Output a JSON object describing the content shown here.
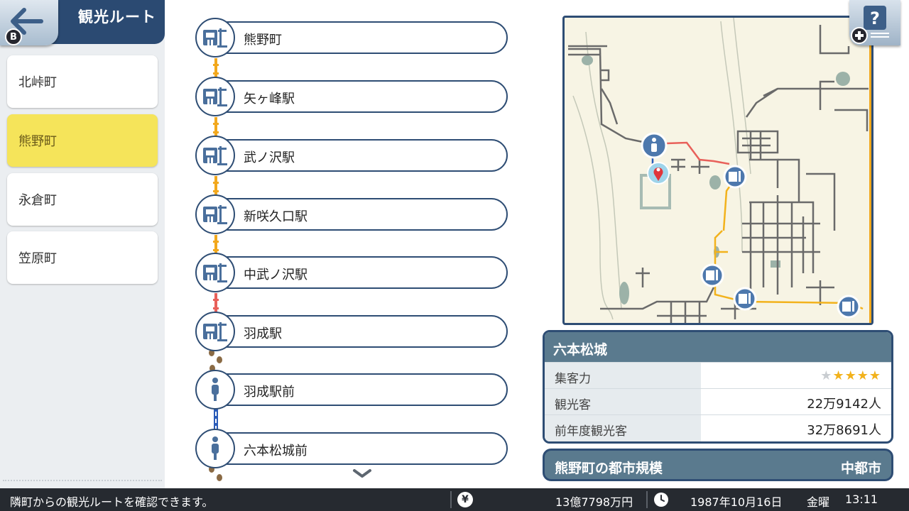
{
  "header": {
    "title": "観光ルート",
    "back_badge": "B"
  },
  "towns": [
    {
      "label": "北峠町",
      "selected": false
    },
    {
      "label": "熊野町",
      "selected": true
    },
    {
      "label": "永倉町",
      "selected": false
    },
    {
      "label": "笠原町",
      "selected": false
    }
  ],
  "route": [
    {
      "label": "熊野町",
      "icon": "station-icon"
    },
    {
      "label": "矢ヶ峰駅",
      "icon": "station-icon"
    },
    {
      "label": "武ノ沢駅",
      "icon": "station-icon"
    },
    {
      "label": "新咲久口駅",
      "icon": "station-icon"
    },
    {
      "label": "中武ノ沢駅",
      "icon": "station-icon"
    },
    {
      "label": "羽成駅",
      "icon": "station-icon"
    },
    {
      "label": "羽成駅前",
      "icon": "bus-stop-icon"
    },
    {
      "label": "六本松城前",
      "icon": "bus-stop-icon"
    }
  ],
  "connectors": [
    "rail-orange",
    "rail-orange",
    "rail-orange",
    "rail-orange",
    "rail-red",
    "walk",
    "bus-blue",
    "walk"
  ],
  "colors": {
    "rail_orange": "#f2a81d",
    "rail_red": "#e8605a",
    "bus_blue": "#2a5bb8",
    "walk": "#8a6a44",
    "navy": "#2e4d74",
    "selected_yellow": "#f5e45a"
  },
  "info": {
    "title": "六本松城",
    "rows": [
      {
        "label": "集客力",
        "stars": 4,
        "max_stars": 5
      },
      {
        "label": "観光客",
        "value": "22万9142人"
      },
      {
        "label": "前年度観光客",
        "value": "32万8691人"
      }
    ]
  },
  "city_scale": {
    "label": "熊野町の都市規模",
    "value": "中都市"
  },
  "status": {
    "message": "隣町からの観光ルートを確認できます。",
    "money": "13億7798万円",
    "date": "1987年10月16日",
    "weekday": "金曜",
    "time": "13:11"
  }
}
